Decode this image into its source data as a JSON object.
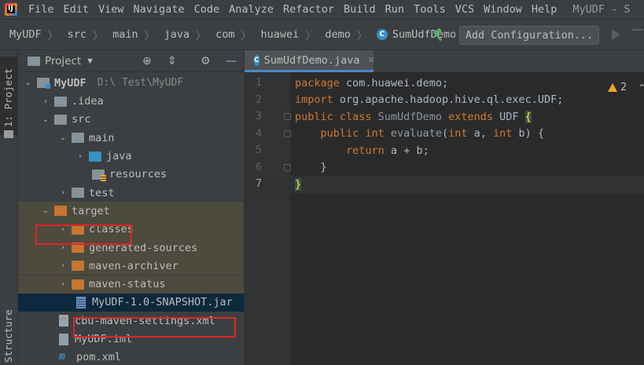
{
  "menubar": {
    "items": [
      "File",
      "Edit",
      "View",
      "Navigate",
      "Code",
      "Analyze",
      "Refactor",
      "Build",
      "Run",
      "Tools",
      "VCS",
      "Window",
      "Help"
    ],
    "window_title": "MyUDF - S"
  },
  "navbar": {
    "breadcrumbs": [
      "MyUDF",
      "src",
      "main",
      "java",
      "com",
      "huawei",
      "demo",
      "SumUdfDemo"
    ],
    "add_config_label": "Add Configuration..."
  },
  "toolstrip": {
    "project_label": "1: Project",
    "structure_label": "Structure"
  },
  "project_panel": {
    "title": "Project",
    "root": {
      "name": "MyUDF",
      "path": "D:\\      Test\\MyUDF"
    },
    "items": [
      {
        "label": ".idea"
      },
      {
        "label": "src"
      },
      {
        "label": "main"
      },
      {
        "label": "java"
      },
      {
        "label": "resources"
      },
      {
        "label": "test"
      },
      {
        "label": "target"
      },
      {
        "label": "classes"
      },
      {
        "label": "generated-sources"
      },
      {
        "label": "maven-archiver"
      },
      {
        "label": "maven-status"
      },
      {
        "label": "MyUDF-1.0-SNAPSHOT.jar"
      },
      {
        "label": "cbu-maven-settings.xml"
      },
      {
        "label": "MyUDF.iml"
      },
      {
        "label": "pom.xml"
      }
    ]
  },
  "editor": {
    "tab_label": "SumUdfDemo.java",
    "warning_count": "2",
    "lines": [
      {
        "n": "1",
        "parts": [
          [
            "kw",
            "package "
          ],
          [
            "t",
            "com.huawei.demo;"
          ]
        ]
      },
      {
        "n": "2",
        "parts": [
          [
            "kw",
            "import "
          ],
          [
            "t",
            "org.apache.hadoop.hive.ql.exec.UDF;"
          ]
        ]
      },
      {
        "n": "3",
        "parts": [
          [
            "kw",
            "public class "
          ],
          [
            "cls",
            "SumUdfDemo "
          ],
          [
            "kw",
            "extends "
          ],
          [
            "t",
            "UDF "
          ],
          [
            "hl",
            "{"
          ]
        ]
      },
      {
        "n": "4",
        "parts": [
          [
            "t",
            "    "
          ],
          [
            "kw",
            "public int "
          ],
          [
            "fn",
            "evaluate"
          ],
          [
            "t",
            "("
          ],
          [
            "kw",
            "int "
          ],
          [
            "t",
            "a, "
          ],
          [
            "kw",
            "int "
          ],
          [
            "t",
            "b) {"
          ]
        ]
      },
      {
        "n": "5",
        "parts": [
          [
            "t",
            "        "
          ],
          [
            "kw",
            "return "
          ],
          [
            "t",
            "a + b;"
          ]
        ]
      },
      {
        "n": "6",
        "parts": [
          [
            "t",
            "    }"
          ]
        ]
      },
      {
        "n": "7",
        "parts": [
          [
            "hl",
            "}"
          ]
        ]
      }
    ]
  }
}
